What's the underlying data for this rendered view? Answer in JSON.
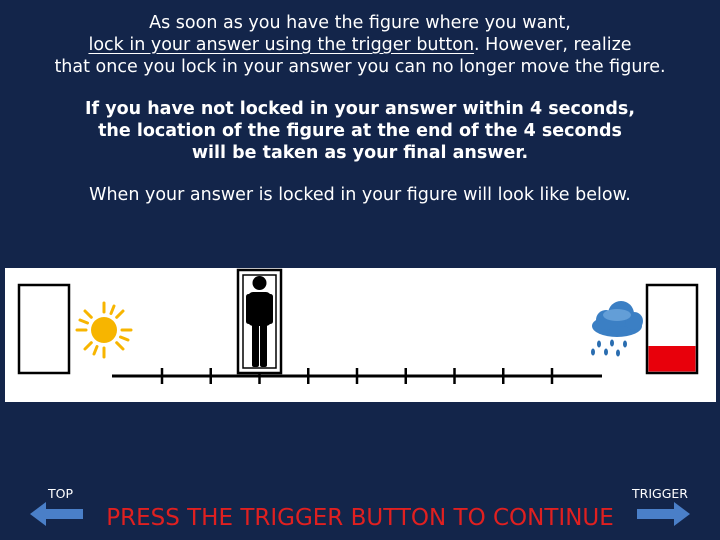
{
  "instructions": {
    "p1_line1": "As soon as you have the figure where you want,",
    "p1_line2_underlined": "lock in your answer using the trigger button",
    "p1_line2_rest": ". However, realize",
    "p1_line3": "that once you lock in your answer you can no longer move the figure.",
    "p2_line1": "If you have not locked in your answer within 4 seconds,",
    "p2_line2": "the location of the figure at the end of the 4 seconds",
    "p2_line3": "will be taken as your final answer.",
    "p3": "When your answer is locked in your figure will look like below."
  },
  "scale": {
    "tick_count": 9,
    "figure_position_index": 2,
    "left_icon": "sun-icon",
    "right_icon": "rain-cloud-icon",
    "right_meter_fill_fraction": 0.3,
    "meter_fill_color": "#e8000b"
  },
  "nav": {
    "top_label": "TOP",
    "trigger_label": "TRIGGER",
    "continue_text": "PRESS THE TRIGGER BUTTON TO CONTINUE"
  },
  "colors": {
    "background": "#13254a",
    "continue_text": "#e02020",
    "arrow": "#4a7fc8"
  }
}
